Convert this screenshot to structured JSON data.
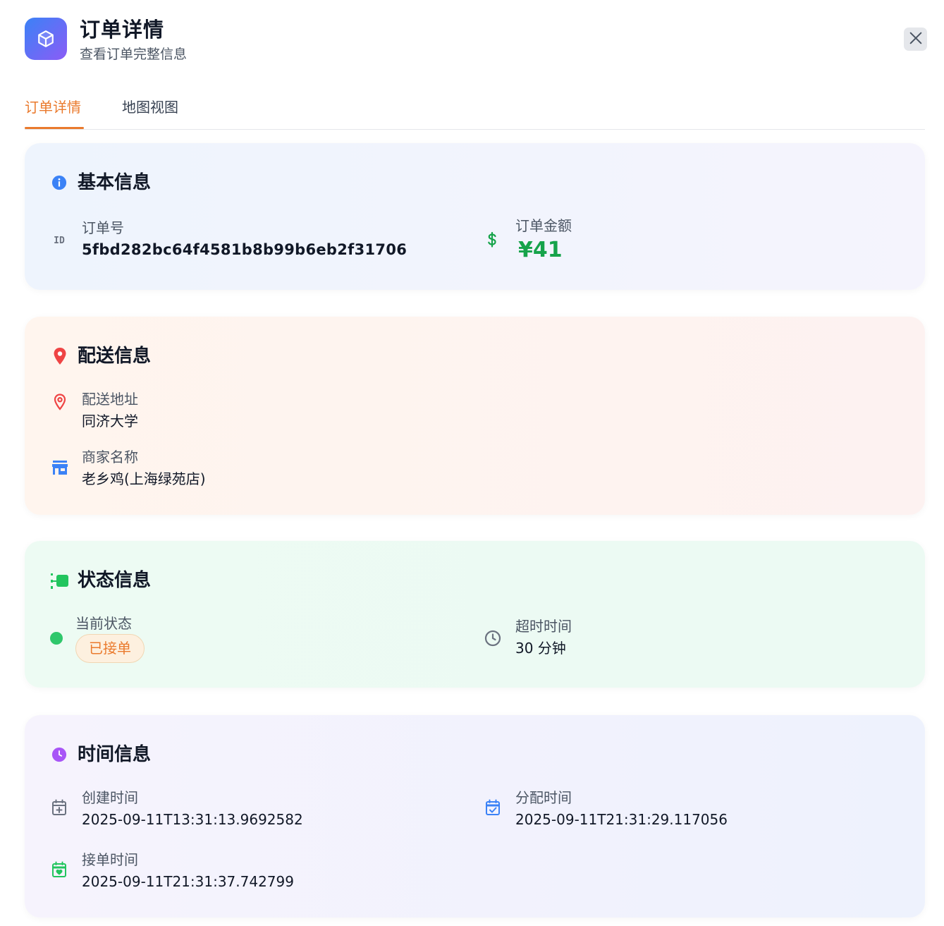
{
  "header": {
    "title": "订单详情",
    "subtitle": "查看订单完整信息"
  },
  "tabs": [
    {
      "label": "订单详情",
      "active": true
    },
    {
      "label": "地图视图",
      "active": false
    }
  ],
  "basic": {
    "title": "基本信息",
    "order_no_icon_text": "ID",
    "order_no_label": "订单号",
    "order_no": "5fbd282bc64f4581b8b99b6eb2f31706",
    "amount_label": "订单金额",
    "amount": "¥41"
  },
  "delivery": {
    "title": "配送信息",
    "address_label": "配送地址",
    "address": "同济大学",
    "merchant_label": "商家名称",
    "merchant": "老乡鸡(上海绿苑店)"
  },
  "status": {
    "title": "状态信息",
    "current_label": "当前状态",
    "current": "已接单",
    "timeout_label": "超时时间",
    "timeout": "30 分钟"
  },
  "time": {
    "title": "时间信息",
    "created_label": "创建时间",
    "created": "2025-09-11T13:31:13.9692582",
    "assigned_label": "分配时间",
    "assigned": "2025-09-11T21:31:29.117056",
    "accepted_label": "接单时间",
    "accepted": "2025-09-11T21:31:37.742799"
  },
  "colors": {
    "accent": "#ea7a2d",
    "amount": "#16a34a",
    "info_blue": "#3b82f6",
    "pin_red": "#ef4444",
    "status_green": "#22c55e",
    "time_purple": "#a855f7"
  },
  "icons": [
    "cube-icon",
    "close-icon",
    "info-icon",
    "id-icon",
    "dollar-icon",
    "location-pin-icon",
    "store-icon",
    "status-list-icon",
    "clock-icon",
    "calendar-plus-icon",
    "calendar-check-icon",
    "calendar-heart-icon"
  ]
}
